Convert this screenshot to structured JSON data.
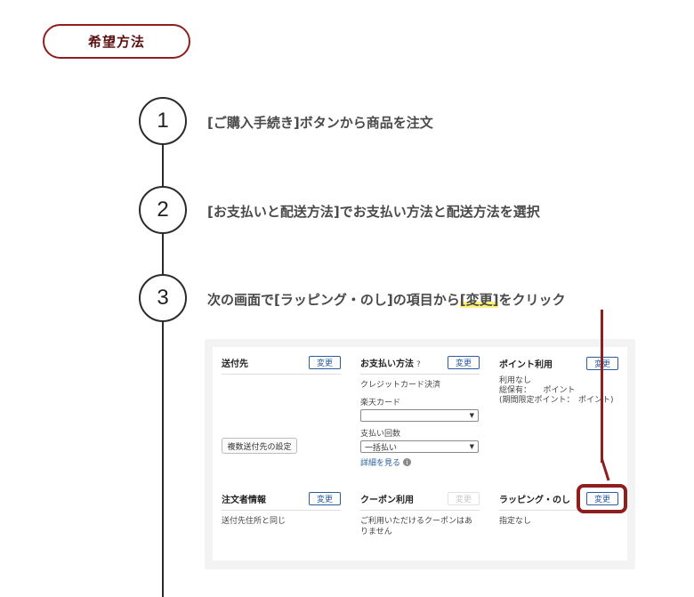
{
  "header": {
    "pill_label": "希望方法"
  },
  "steps": [
    {
      "number": "1",
      "text_before": "[ご購入手続き]ボタンから商品を注文",
      "highlight": "",
      "text_after": ""
    },
    {
      "number": "2",
      "text_before": "[お支払いと配送方法]でお支払い方法と配送方法を選択",
      "highlight": "",
      "text_after": ""
    },
    {
      "number": "3",
      "text_before": "次の画面で[ラッピング・のし]の項目から",
      "highlight": "[変更]",
      "text_after": "をクリック"
    }
  ],
  "panel": {
    "shipping": {
      "title": "送付先",
      "change": "変更",
      "multi_button": "複数送付先の設定"
    },
    "payment": {
      "title": "お支払い方法",
      "help": "?",
      "change": "変更",
      "method": "クレジットカード決済",
      "card_label": "楽天カード",
      "card_value": "",
      "count_label": "支払い回数",
      "count_value": "一括払い",
      "details_link": "詳細を見る"
    },
    "points": {
      "title": "ポイント利用",
      "change": "変更",
      "line1": "利用なし",
      "line2": "総保有：　　ポイント",
      "line3": "(期間限定ポイント：　ポイント)"
    },
    "orderer": {
      "title": "注文者情報",
      "change": "変更",
      "body": "送付先住所と同じ"
    },
    "coupon": {
      "title": "クーポン利用",
      "change": "変更",
      "body": "ご利用いただけるクーポンはありません"
    },
    "wrapping": {
      "title": "ラッピング・のし",
      "change": "変更",
      "body": "指定なし"
    }
  },
  "colors": {
    "accent": "#8f1f1f",
    "highlight": "#fff27a",
    "link": "#2b5c9e"
  }
}
